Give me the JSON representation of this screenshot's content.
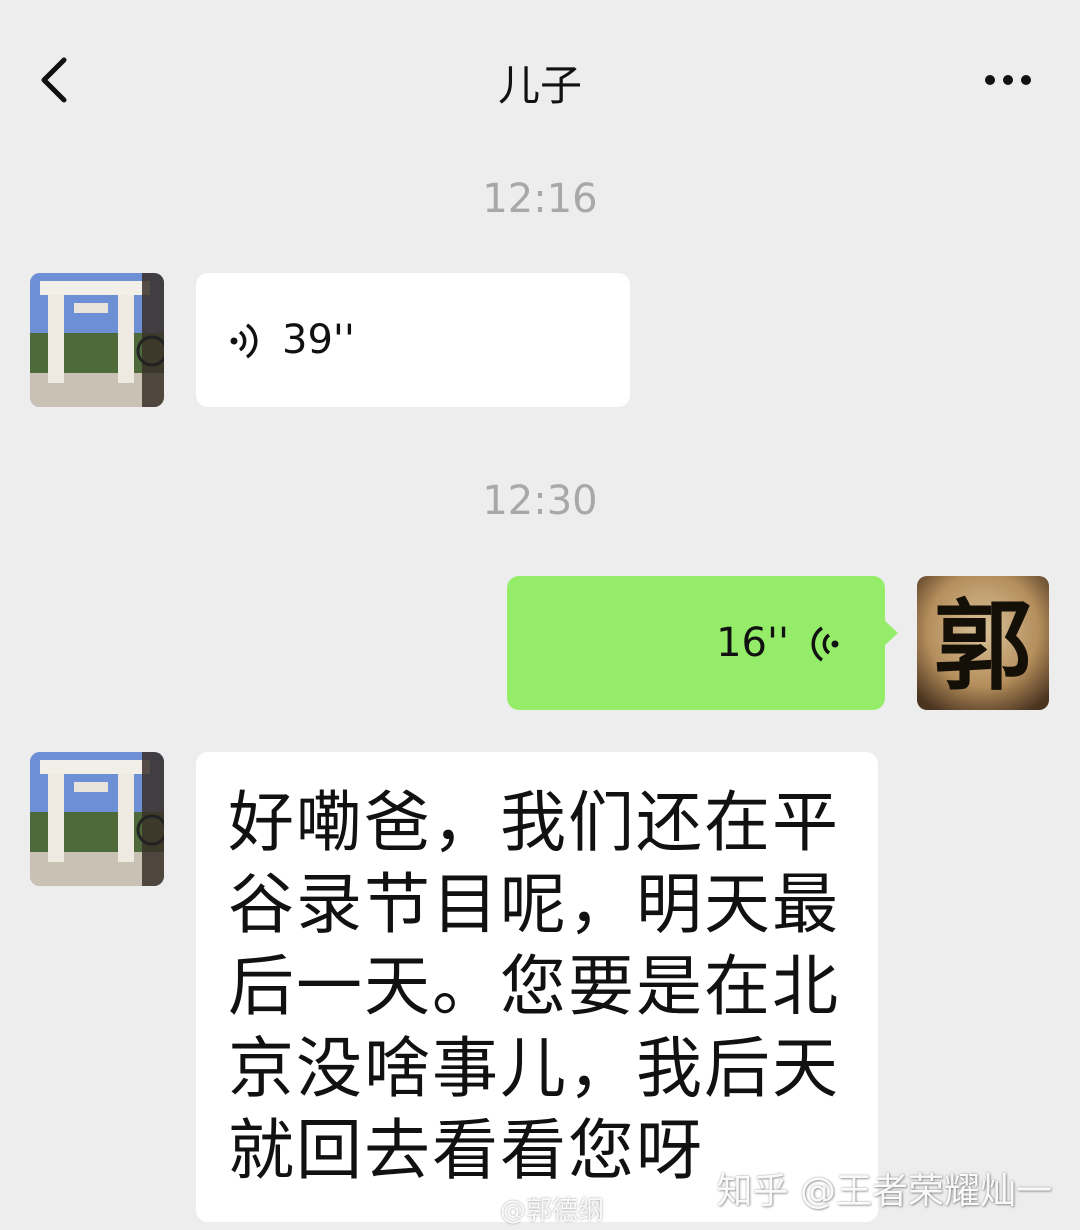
{
  "header": {
    "title": "儿子",
    "back_icon": "chevron-left-icon",
    "more_icon": "more-dots-icon"
  },
  "messages": [
    {
      "type": "timestamp",
      "text": "12:16"
    },
    {
      "type": "voice",
      "side": "left",
      "duration": "39''"
    },
    {
      "type": "timestamp",
      "text": "12:30"
    },
    {
      "type": "voice",
      "side": "right",
      "duration": "16''"
    },
    {
      "type": "text",
      "side": "left",
      "text": "好嘞爸，我们还在平谷录节目呢，明天最后一天。您要是在北京没啥事儿，我后天就回去看看您呀"
    }
  ],
  "avatars": {
    "contact_avatar": "archway-photo-avatar",
    "self_avatar_char": "郭"
  },
  "watermarks": {
    "zhihu": "知乎 @王者荣耀灿一",
    "weibo": "@郭德纲"
  },
  "colors": {
    "background": "#ededed",
    "sent_bubble": "#95ec69",
    "received_bubble": "#ffffff",
    "timestamp_text": "#a8a8a8"
  }
}
